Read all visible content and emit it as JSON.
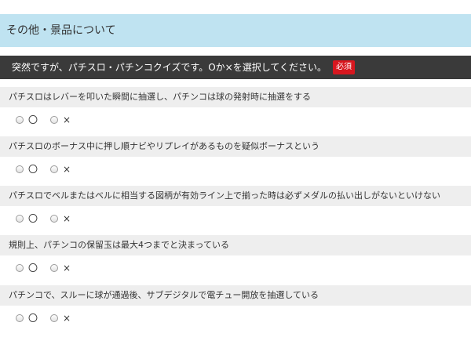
{
  "section": {
    "title": "その他・景品について"
  },
  "question": {
    "text": "突然ですが、パチスロ・パチンコクイズです。Oか×を選択してください。",
    "badge": "必須"
  },
  "options": {
    "circle": "〇",
    "cross": "×"
  },
  "items": [
    {
      "text": "パチスロはレバーを叩いた瞬間に抽選し、パチンコは球の発射時に抽選をする"
    },
    {
      "text": "パチスロのボーナス中に押し順ナビやリプレイがあるものを疑似ボーナスという"
    },
    {
      "text": "パチスロでベルまたはベルに相当する図柄が有効ライン上で揃った時は必ずメダルの払い出しがないといけない"
    },
    {
      "text": "規則上、パチンコの保留玉は最大4つまでと決まっている"
    },
    {
      "text": "パチンコで、スルーに球が通過後、サブデジタルで電チュー開放を抽選している"
    }
  ],
  "colors": {
    "header_bg": "#bfe3f1",
    "question_bg": "#3a3a3a",
    "badge_bg": "#d7171f",
    "row_bg": "#eeeeee"
  }
}
